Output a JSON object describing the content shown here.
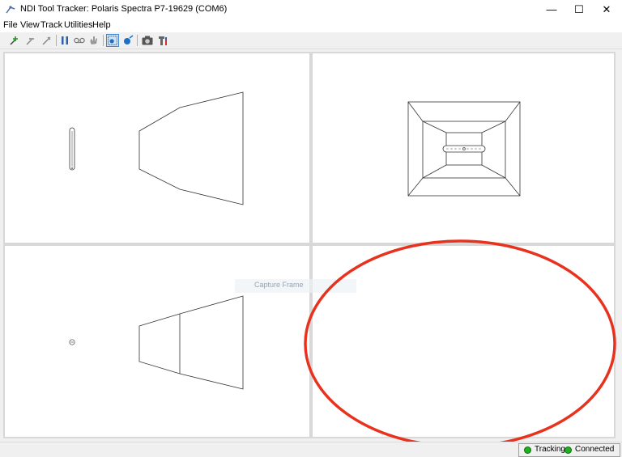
{
  "window": {
    "title": "NDI Tool Tracker: Polaris Spectra P7-19629 (COM6)",
    "controls": {
      "minimize": "—",
      "maximize": "☐",
      "close": "✕"
    }
  },
  "menu": {
    "items": [
      {
        "label": "File"
      },
      {
        "label": "View"
      },
      {
        "label": "Track"
      },
      {
        "label": "Utilities"
      },
      {
        "label": "Help"
      }
    ]
  },
  "toolbar": {
    "icons": [
      "add-tool-icon",
      "remove-tool-icon",
      "configure-tool-icon",
      "pause-icon",
      "record-icon",
      "hand-icon",
      "select-view-icon",
      "eye-target-icon",
      "camera-icon",
      "tools-icon"
    ],
    "active": "select-view-icon"
  },
  "overlay": {
    "ghost_label": "Capture Frame"
  },
  "status": {
    "tracking_label": "Tracking",
    "connected_label": "Connected",
    "led_color": "#1db31d"
  },
  "annotation": {
    "color": "#e8321e"
  }
}
